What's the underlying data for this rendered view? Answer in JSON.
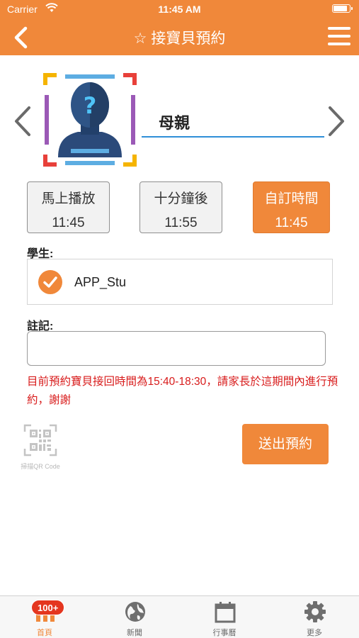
{
  "status_bar": {
    "carrier": "Carrier",
    "time": "11:45 AM"
  },
  "nav": {
    "title": "☆ 接寶貝預約"
  },
  "guardian": {
    "name": "母親"
  },
  "time_options": [
    {
      "label": "馬上播放",
      "time": "11:45",
      "selected": false
    },
    {
      "label": "十分鐘後",
      "time": "11:55",
      "selected": false
    },
    {
      "label": "自訂時間",
      "time": "11:45",
      "selected": true
    }
  ],
  "student_section": {
    "label": "學生:",
    "student_name": "APP_Stu",
    "checked": true
  },
  "note_section": {
    "label": "註記:",
    "value": "",
    "placeholder": ""
  },
  "notice": "目前預約寶貝接回時間為15:40-18:30，請家長於這期間內進行預約，謝謝",
  "qr": {
    "caption": "掃描QR Code"
  },
  "submit": {
    "label": "送出預約"
  },
  "tabbar": {
    "badge": "100+",
    "tabs": [
      {
        "label": "首頁",
        "icon": "home-icon",
        "active": true
      },
      {
        "label": "新聞",
        "icon": "globe-icon",
        "active": false
      },
      {
        "label": "行事曆",
        "icon": "calendar-icon",
        "active": false
      },
      {
        "label": "更多",
        "icon": "gear-icon",
        "active": false
      }
    ]
  },
  "colors": {
    "accent": "#f0883a",
    "notice_red": "#d81b1b",
    "underline_blue": "#2f8fd8",
    "badge_red": "#e4361f"
  }
}
